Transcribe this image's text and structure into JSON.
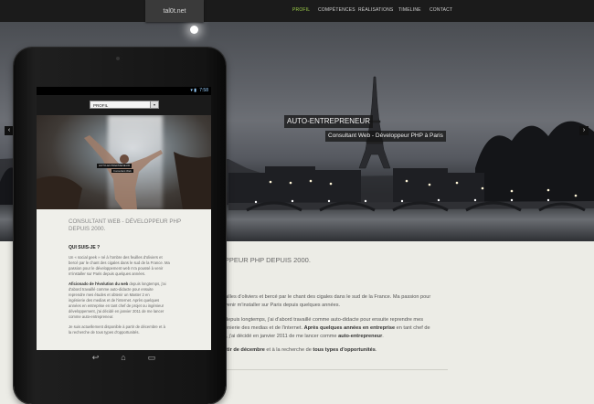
{
  "site": {
    "logo": "tal0t.net",
    "nav": [
      {
        "label": "PROFIL",
        "active": true
      },
      {
        "label": "COMPÉTENCES",
        "active": false
      },
      {
        "label": "RÉALISATIONS",
        "active": false
      },
      {
        "label": "TIMELINE",
        "active": false
      },
      {
        "label": "CONTACT",
        "active": false
      }
    ]
  },
  "hero": {
    "title": "AUTO-ENTREPRENEUR",
    "subtitle": "Consultant Web - Développeur PHP à Paris",
    "prev_icon": "‹",
    "next_icon": "›"
  },
  "content": {
    "line_sub": "OPPEUR PHP DEPUIS 2000.",
    "l1": "ailles d'oliviers et bercé par le chant des cigales dans le sud de la France. Ma passion pour",
    "l2": "venir m'installer sur Paris depuis quelques années.",
    "l3": "depuis longtemps, j'ai d'abord travaillé comme auto-didacte pour ensuite reprendre mes",
    "l4a": "énierie des medias et de l'internet. ",
    "l4b": "Après quelques années en entreprise",
    "l4c": " en tant chef de",
    "l5a": "r, j'ai décidé en janvier 2011 de me lancer comme ",
    "l5b": "auto-entrepreneur",
    "l5c": ".",
    "l6a": "rtir de décembre",
    "l6b": " et à la recherche de ",
    "l6c": "tous types d'opportunités",
    "l6d": "."
  },
  "tablet": {
    "status_time": "7:58",
    "status_icons": "▾ ▮",
    "select_value": "PROFIL",
    "select_arrow": "▾",
    "hero_title": "AUTO-ENTREPRENEUR",
    "hero_sub": "Consultant Web",
    "subtitle_l1": "CONSULTANT WEB - DÉVELOPPEUR PHP",
    "subtitle_l2": "DEPUIS 2000.",
    "heading": "QUI SUIS-JE ?",
    "p1": [
      "Un « social geek » né à l'ombre des feuilles d'oliviers et",
      "bercé par le chant des cigales dans le sud de la France. Ma",
      "passion pour le développement web m'a poussé à venir",
      "m'installer sur Paris depuis quelques années."
    ],
    "p2a": "Aficionado de l'évolution du web",
    "p2a_rest": " depuis longtemps, j'ai",
    "p2": [
      "d'abord travaillé comme auto-didacte pour ensuite",
      "reprendre mes études et obtenir un Master 2 en",
      "ingénierie des medias et de l'internet. Après quelques",
      "années en entreprise en tant chef de projet ou ingénieur",
      "développement, j'ai décidé en janvier 2011 de me lancer",
      "comme auto-entrepreneur."
    ],
    "p3": [
      "Je suis actuellement disponible à partir de décembre et à",
      "la recherche de tous types d'opportunités."
    ],
    "keys": [
      "↩",
      "⌂",
      "▭"
    ]
  },
  "colors": {
    "nav_active": "#9ecf4a",
    "topbar": "#1b1b1b",
    "page_bg": "#ecece6"
  }
}
